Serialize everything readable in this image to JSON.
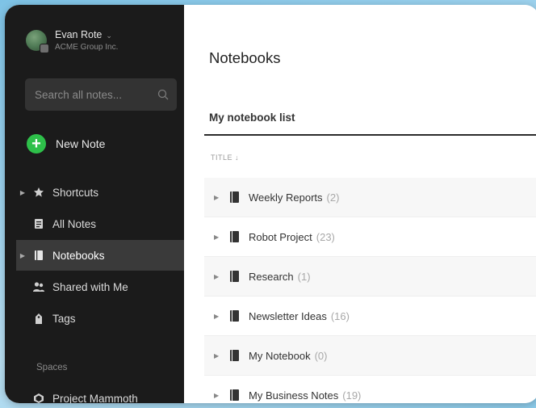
{
  "account": {
    "name": "Evan Rote",
    "org": "ACME Group Inc."
  },
  "search": {
    "placeholder": "Search all notes..."
  },
  "new_note": {
    "label": "New Note"
  },
  "nav": {
    "items": [
      {
        "label": "Shortcuts",
        "icon": "star-icon"
      },
      {
        "label": "All Notes",
        "icon": "note-icon"
      },
      {
        "label": "Notebooks",
        "icon": "notebook-icon",
        "active": true
      },
      {
        "label": "Shared with Me",
        "icon": "people-icon"
      },
      {
        "label": "Tags",
        "icon": "tag-icon"
      }
    ]
  },
  "spaces": {
    "header": "Spaces",
    "items": [
      {
        "label": "Project Mammoth",
        "icon": "space-icon"
      }
    ]
  },
  "main": {
    "title": "Notebooks",
    "list_title": "My notebook list",
    "column_header": "TITLE",
    "notebooks": [
      {
        "name": "Weekly Reports",
        "count": "(2)"
      },
      {
        "name": "Robot Project",
        "count": "(23)"
      },
      {
        "name": "Research",
        "count": "(1)"
      },
      {
        "name": "Newsletter Ideas",
        "count": "(16)"
      },
      {
        "name": "My Notebook",
        "count": "(0)"
      },
      {
        "name": "My Business Notes",
        "count": "(19)"
      }
    ]
  },
  "colors": {
    "accent_green": "#2ec04a",
    "sidebar_bg": "#1b1b1b",
    "active_bg": "#3a3a3a"
  }
}
